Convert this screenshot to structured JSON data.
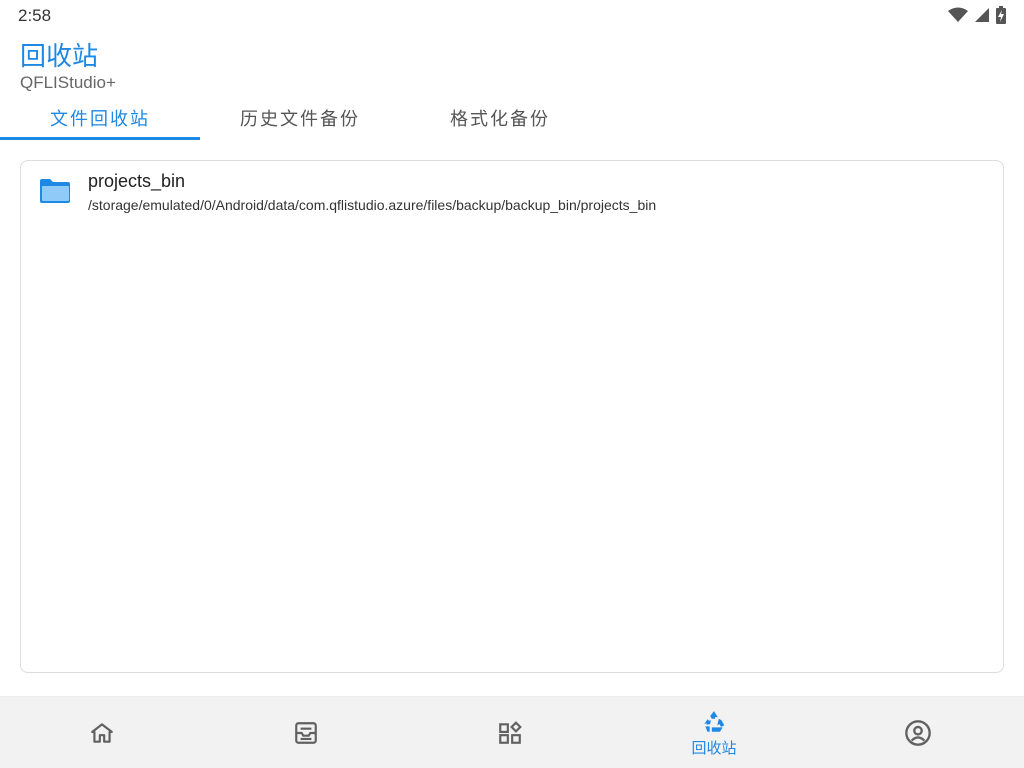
{
  "status_bar": {
    "time": "2:58",
    "icons": [
      "wifi-icon",
      "cellular-signal-icon",
      "battery-charging-icon"
    ]
  },
  "header": {
    "title": "回收站",
    "subtitle": "QFLIStudio+"
  },
  "tabs": [
    {
      "label": "文件回收站",
      "active": true
    },
    {
      "label": "历史文件备份",
      "active": false
    },
    {
      "label": "格式化备份",
      "active": false
    }
  ],
  "files": [
    {
      "icon": "folder-icon",
      "name": "projects_bin",
      "path": "/storage/emulated/0/Android/data/com.qflistudio.azure/files/backup/backup_bin/projects_bin"
    }
  ],
  "bottom_nav": [
    {
      "icon": "home-icon",
      "label": "",
      "active": false
    },
    {
      "icon": "inbox-icon",
      "label": "",
      "active": false
    },
    {
      "icon": "apps-icon",
      "label": "",
      "active": false
    },
    {
      "icon": "recycle-icon",
      "label": "回收站",
      "active": true
    },
    {
      "icon": "account-icon",
      "label": "",
      "active": false
    }
  ],
  "colors": {
    "accent": "#1e88e5",
    "folder": "#64b5f6",
    "nav_background": "#f2f2f2",
    "icon_inactive": "#616161"
  }
}
